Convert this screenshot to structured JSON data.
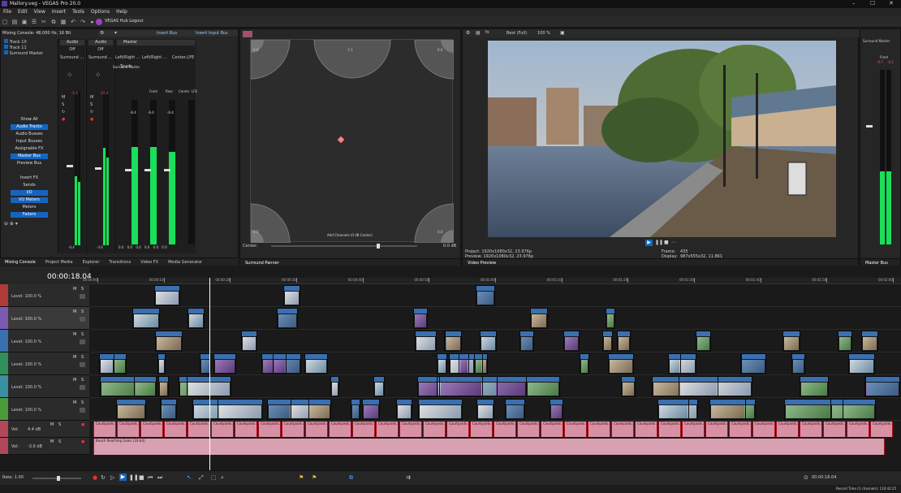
{
  "window": {
    "title": "Mallory.veg - VEGAS Pro 20.0"
  },
  "menu": [
    "File",
    "Edit",
    "View",
    "Insert",
    "Tools",
    "Options",
    "Help"
  ],
  "toolbar": {
    "hub_label": "VEGAS Hub Logout"
  },
  "mixer": {
    "header": "Mixing Console: 48,000 Hz, 16 Bit",
    "tracks": [
      "Track 10",
      "Track 11",
      "Surround Master"
    ],
    "insert_bus": "Insert Bus",
    "insert_input_bus": "Insert Input Bus",
    "channels": [
      {
        "name": "Audio",
        "mode": "Off",
        "pan": "Surround ...",
        "peak": "-5.4",
        "value": "-4.4"
      },
      {
        "name": "Audio",
        "mode": "Off",
        "pan": "Surround ...",
        "peak": "-22.4",
        "value": "-3.6"
      }
    ],
    "master": {
      "name": "Master",
      "pan": "Left/Right ...",
      "pan2": "Left/Right ...",
      "pan3": "Center,LFE",
      "touch": "Touch",
      "chans": [
        "Front",
        "Rear",
        "Center",
        "LFE"
      ],
      "peaks": [
        "-6.4",
        "-6.4",
        "-6.4"
      ],
      "vals": [
        "0.0",
        "0.0",
        "0.0",
        "0.0",
        "0.0",
        "0.0",
        "0.0",
        "0.0"
      ],
      "footer": "Surround Master"
    },
    "side_buttons": [
      "Show All",
      "Audio Tracks",
      "Audio Busses",
      "Input Busses",
      "Assignable FX",
      "Master Bus",
      "Preview Bus",
      "Insert FX",
      "Sends",
      "I/O",
      "VU Meters",
      "Meters",
      "Faders"
    ],
    "active_side": [
      "Audio Tracks",
      "Master Bus",
      "I/O",
      "VU Meters",
      "Faders"
    ]
  },
  "tabs_left": [
    "Mixing Console",
    "Project Media",
    "Explorer",
    "Transitions",
    "Video FX",
    "Media Generator"
  ],
  "panner": {
    "corners": [
      "0.0",
      "-7.1",
      "0.0",
      "0.0",
      "0.0",
      "0.0"
    ],
    "center_label": "Center:",
    "center_val": "0.0 dB",
    "add_label": "Add Channels (0 dB Center)",
    "tab": "Surround Panner"
  },
  "preview": {
    "quality": "Best (Full)",
    "zoom": "100 %",
    "project": "Project:   1920x1080x32, 23.976p",
    "preview": "Preview:  1920x1080x32, 23.976p",
    "frame_label": "Frame:",
    "frame": "435",
    "display_label": "Display:",
    "display": "987x555x32, 11.861",
    "tab": "Video Preview"
  },
  "master_bus": {
    "title": "Surround Master",
    "front": "Front",
    "peaks": [
      "-6.7",
      "-6.5"
    ],
    "tab": "Master Bus"
  },
  "timeline": {
    "timecode": "00:00:18.04",
    "ruler": [
      "00:00:00",
      "00:00:10",
      "00:00:20",
      "00:00:30",
      "00:00:40",
      "00:00:50",
      "00:01:00",
      "00:01:10",
      "00:01:20",
      "00:01:30",
      "00:01:40",
      "00:01:50",
      "00:02:00"
    ],
    "video_tracks": [
      {
        "level": "Level: 100.0 %",
        "color": "#b03a3a"
      },
      {
        "level": "Level: 100.0 %",
        "color": "#7b5ab0"
      },
      {
        "level": "Level: 100.0 %",
        "color": "#3a6fb0"
      },
      {
        "level": "Level: 100.0 %",
        "color": "#2f8f5a"
      },
      {
        "level": "Level: 100.0 %",
        "color": "#3a8fa0"
      },
      {
        "level": "Level: 100.0 %",
        "color": "#4a9a3a"
      }
    ],
    "audio_tracks": [
      {
        "vol": "Vol:",
        "val": "4.4 dB",
        "color": "#b0485a"
      },
      {
        "vol": "Vol:",
        "val": "-3.6 dB",
        "color": "#b0485a"
      }
    ],
    "audio_clip": "Courtyards at Mallory",
    "music_clip": "Beach Reaching Goals (24-bit)",
    "rate": "Rate: 1.00",
    "transport_time": "00:00:18.04",
    "record_time": "Record Time (2 channels): 110:42:25"
  },
  "colors": {
    "accent": "#1565c0",
    "meter": "#18e05a",
    "audio": "#d890a4"
  }
}
